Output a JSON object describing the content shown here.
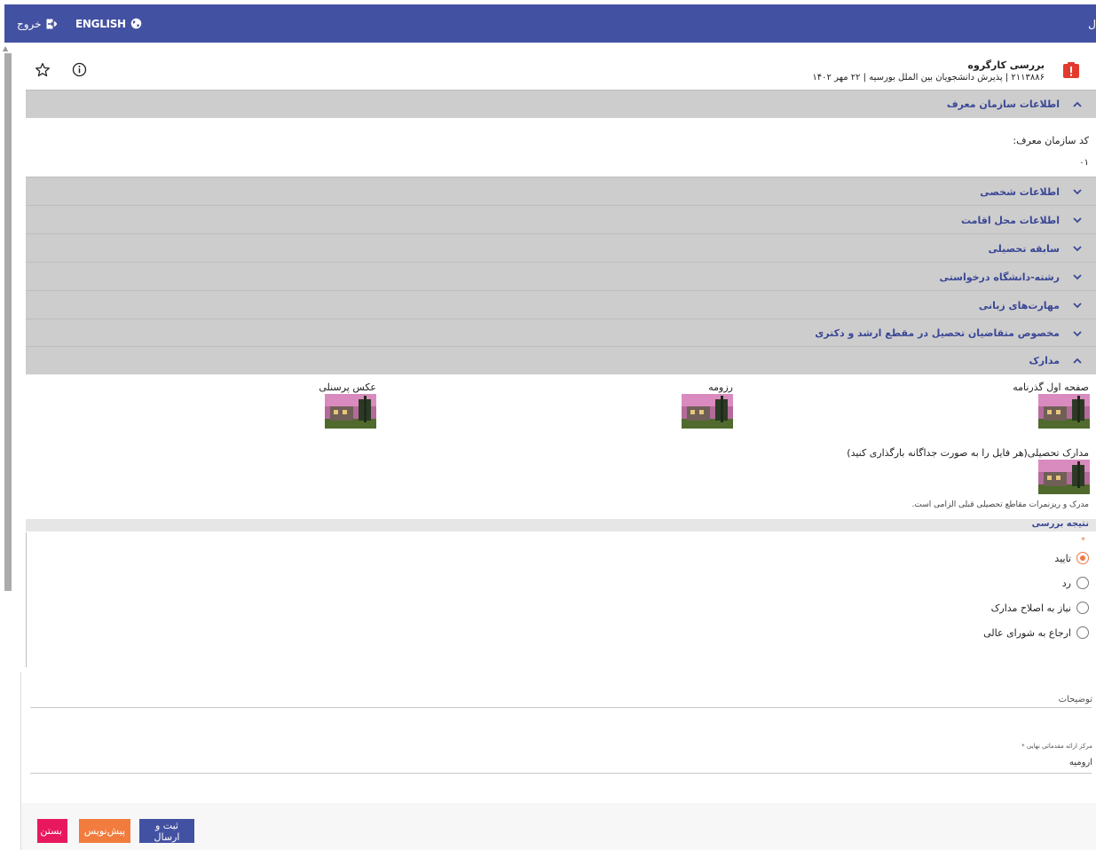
{
  "topbar": {
    "exit_label": "خروج",
    "lang_label": "ENGLISH",
    "edge_text": "ل",
    "bg_color": "#4351a2"
  },
  "header": {
    "task_title": "بررسی کارگروه",
    "task_subtitle": "۲۱۱۳۸۸۶ | پذیرش دانشجویان بین الملل بورسیه | ۲۲ مهر ۱۴۰۲",
    "icons": [
      "star-icon",
      "info-icon",
      "alert-icon"
    ]
  },
  "sections": {
    "org_info": "اطلاعات سازمان معرف",
    "personal_info": "اطلاعات شخصی",
    "residence_info": "اطلاعات محل اقامت",
    "education_history": "سابقه تحصیلی",
    "requested_field": "رشته-دانشگاه درخواستی",
    "language_skills": "مهارت‌های زبانی",
    "masters_phd": "مخصوص متقاضیان تحصیل در مقطع ارشد و دکتری",
    "documents": "مدارک"
  },
  "org": {
    "code_label": "کد سازمان معرف:",
    "code_value": "۰۱"
  },
  "documents": {
    "passport_label": "صفحه اول گذرنامه",
    "resume_label": "رزومه",
    "photo_label": "عکس پرسنلی",
    "edu_docs_label": "مدارک تحصیلی(هر فایل را به صورت جداگانه بارگذاری کنید)",
    "edu_docs_note": "مدرک و ریزنمرات مقاطع تحصیلی قبلی الزامی است."
  },
  "review": {
    "title": "نتیجه بررسی",
    "required_mark": "*",
    "options": [
      "تایید",
      "رد",
      "نیاز به اصلاح مدارک",
      "ارجاع به شورای عالی"
    ],
    "selected_index": 0
  },
  "form": {
    "description_label": "توضیحات",
    "center_label": "مرکز ارائه مقدماتی نهایی *",
    "center_value": "ارومیه"
  },
  "buttons": {
    "submit": "ثبت و ارسال",
    "draft": "پیش‌نویس",
    "close": "بستن"
  },
  "colors": {
    "primary": "#4351a2",
    "accent_orange": "#f27c3d",
    "danger_pink": "#e8185f",
    "section_gray": "#cdcdcd"
  }
}
